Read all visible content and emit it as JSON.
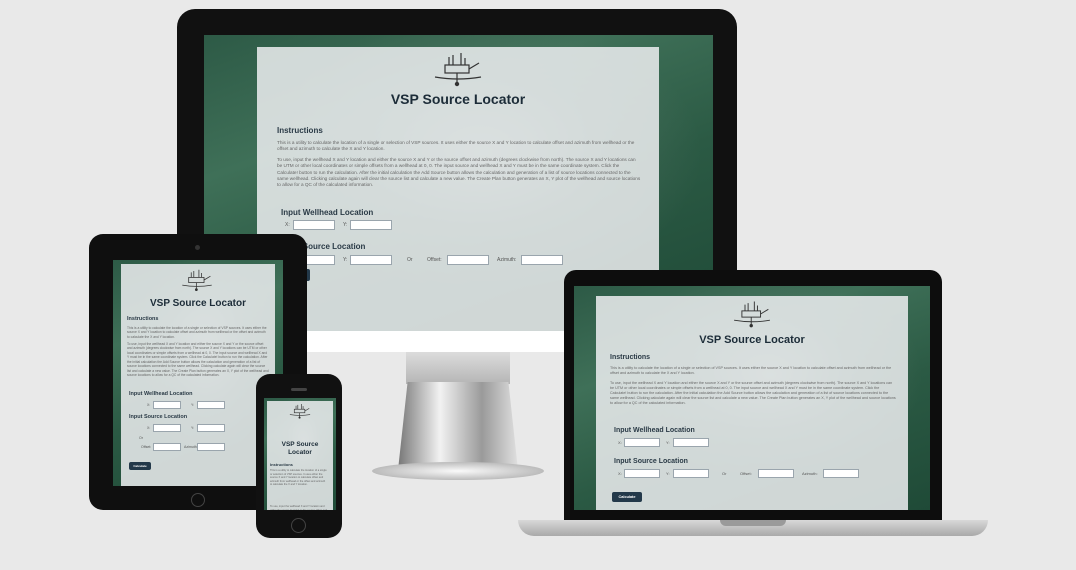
{
  "app": {
    "title": "VSP Source Locator",
    "instructions_heading": "Instructions",
    "intro": "This is a utility to calculate the location of a single or selection of VSP sources. It uses either the source X and Y location to calculate offset and azimuth from wellhead or the offset and azimuth to calculate the X and Y location.",
    "details": "To use, input the wellhead X and Y location and either the source X and Y or the source offset and azimuth (degrees clockwise from north). The source X and Y locations can be UTM or other local coordinates or simple offsets from a wellhead at 0, 0. The input source and wellhead X and Y must be in the same coordinate system. Click the Calculate! button to run the calculation. After the initial calculation the Add Source button allows the calculation and generation of a list of source locations connected to the same wellhead. Clicking calculate again will clear the source list and calculate a new value. The Create Plan button generates an X, Y plot of the wellhead and source locations to allow for a QC of the calculated information.",
    "wellhead_heading": "Input Wellhead Location",
    "source_heading": "Input Source Location",
    "labels": {
      "x": "X:",
      "y": "Y:",
      "or": "Or",
      "offset": "Offset:",
      "azimuth": "Azimuth:"
    },
    "calculate_label": "Calculate"
  },
  "colors": {
    "ocean": "#2d5a46",
    "card": "#eceef0",
    "button": "#23394a",
    "title": "#1c2c38"
  },
  "icons": {
    "logo": "oil-rig-icon"
  }
}
